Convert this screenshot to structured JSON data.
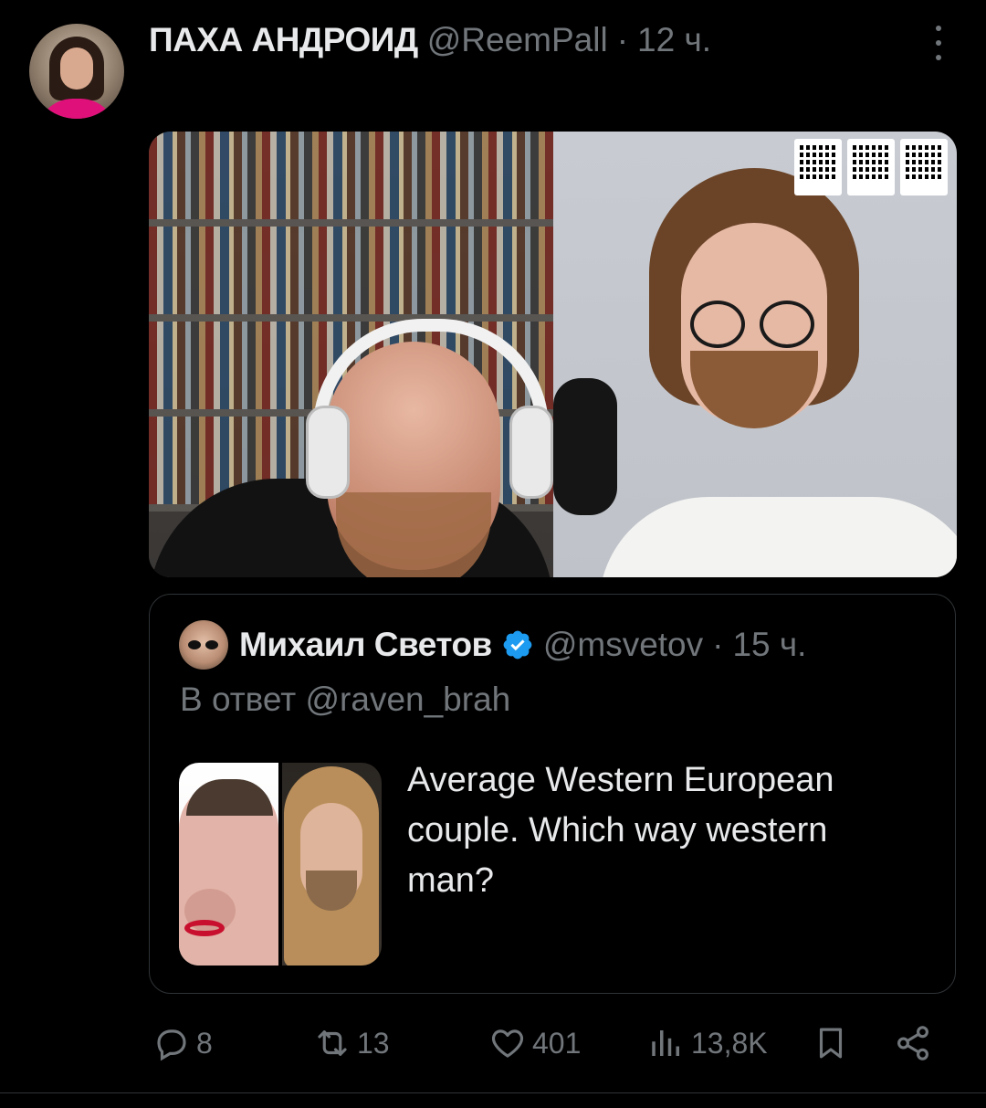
{
  "post": {
    "author_name": "ПАХА АНДРОИД",
    "author_handle": "@ReemPall",
    "separator": "·",
    "time": "12 ч."
  },
  "quote": {
    "author_name": "Михаил Светов",
    "author_handle": "@msvetov",
    "separator": "·",
    "time": "15 ч.",
    "reply_to": "В ответ @raven_brah",
    "text": "Average Western European couple. Which way western man?"
  },
  "actions": {
    "replies": "8",
    "reposts": "13",
    "likes": "401",
    "views": "13,8K"
  },
  "colors": {
    "background": "#000000",
    "text": "#e7e9ea",
    "muted": "#71767b",
    "border": "#2f3336",
    "verified": "#1d9bf0"
  },
  "icons": {
    "reply": "reply-icon",
    "repost": "repost-icon",
    "like": "heart-icon",
    "views": "views-icon",
    "bookmark": "bookmark-icon",
    "share": "share-icon",
    "more": "more-icon",
    "verified": "verified-icon"
  }
}
